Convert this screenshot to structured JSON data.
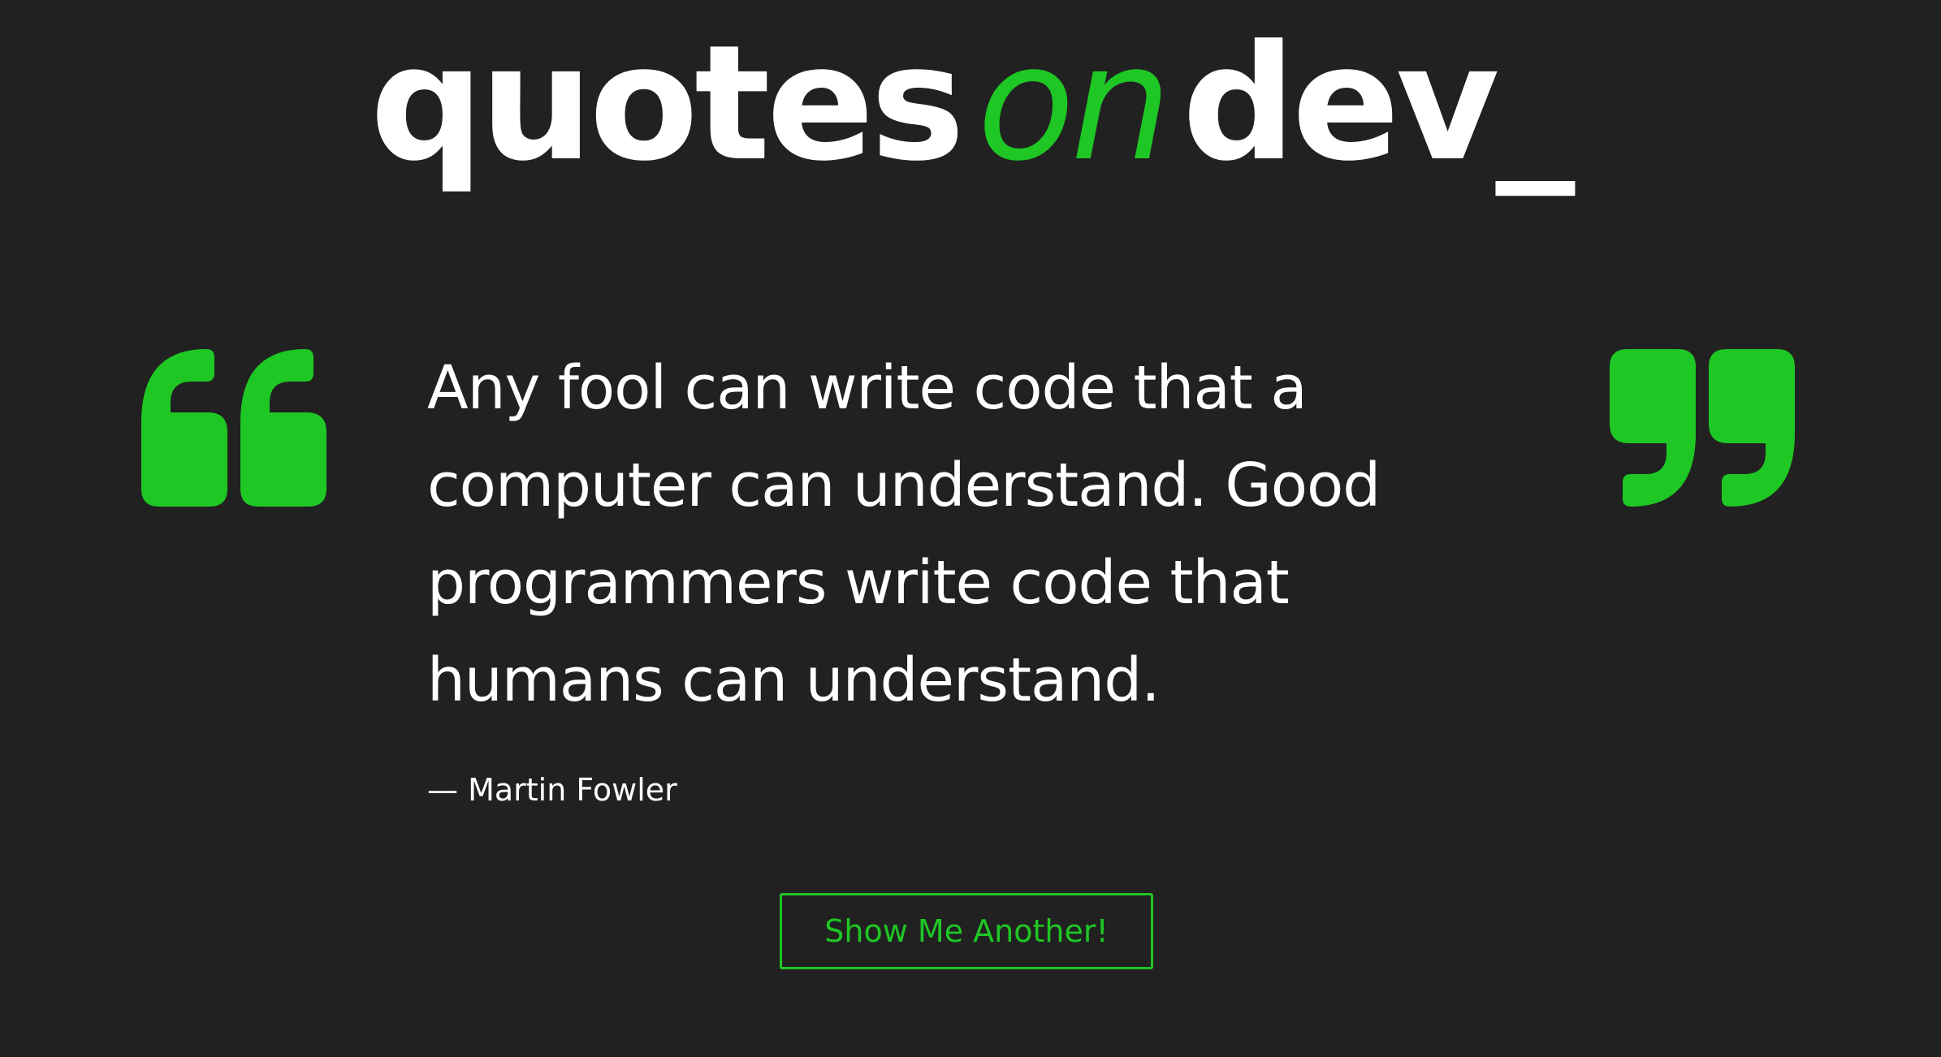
{
  "header": {
    "logo_word_1": "quotes",
    "logo_word_2": "on",
    "logo_word_3": "dev_"
  },
  "quote": {
    "text": "Any fool can write code that a computer can understand. Good programmers write code that humans can understand.",
    "attribution": "— Martin Fowler",
    "open_mark_icon": "open-quote-icon",
    "close_mark_icon": "close-quote-icon"
  },
  "actions": {
    "show_another_label": "Show Me Another!"
  },
  "colors": {
    "background": "#212121",
    "accent": "#1ec724",
    "text": "#ffffff"
  }
}
